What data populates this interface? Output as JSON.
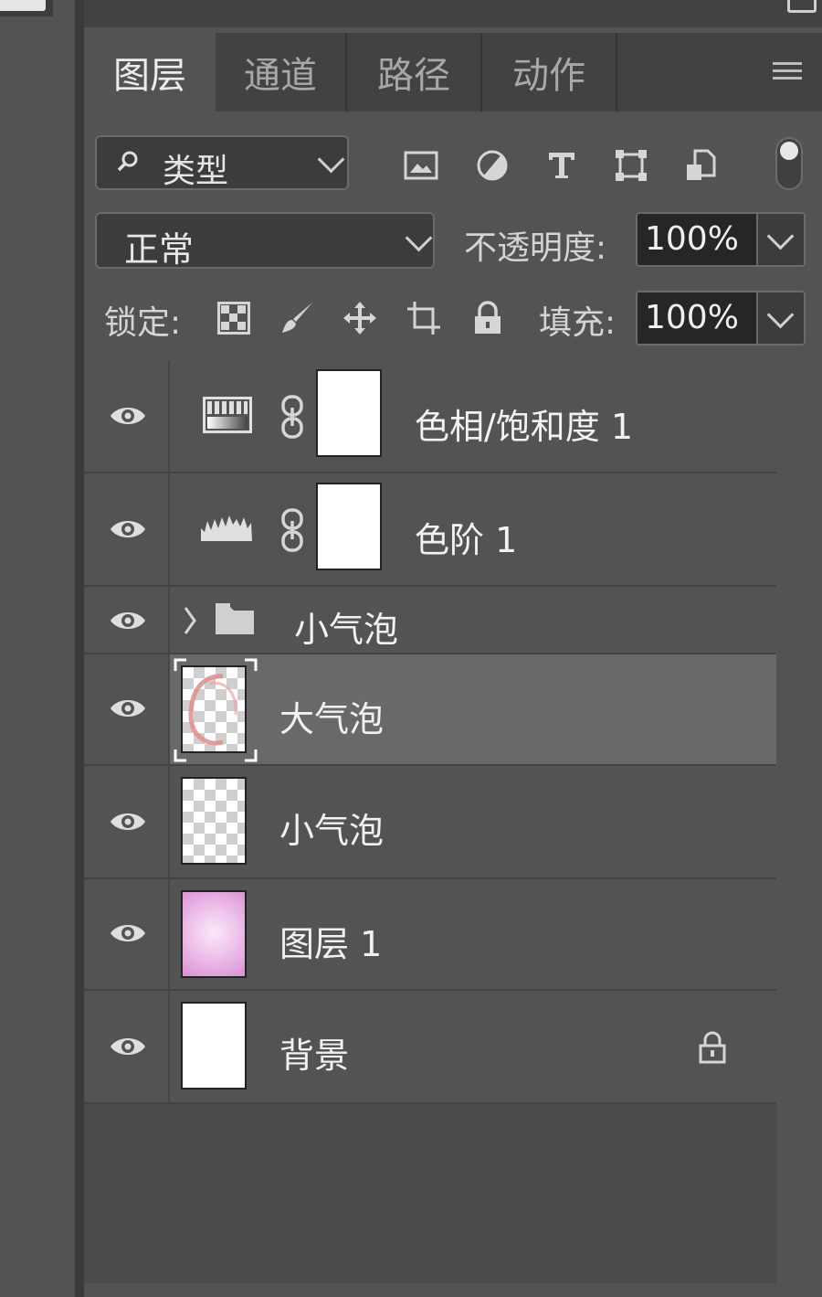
{
  "tabs": [
    {
      "label": "图层",
      "active": true
    },
    {
      "label": "通道",
      "active": false
    },
    {
      "label": "路径",
      "active": false
    },
    {
      "label": "动作",
      "active": false
    }
  ],
  "filter": {
    "kind_label": "类型",
    "icons": [
      "image-filter-icon",
      "adjustment-filter-icon",
      "type-filter-icon",
      "shape-filter-icon",
      "smart-object-filter-icon"
    ]
  },
  "blend": {
    "mode": "正常",
    "opacity_label": "不透明度:",
    "opacity_value": "100%"
  },
  "lock": {
    "label": "锁定:",
    "icons": [
      "lock-transparent-pixels-icon",
      "lock-image-pixels-icon",
      "lock-position-icon",
      "lock-artboard-icon",
      "lock-all-icon"
    ],
    "fill_label": "填充:",
    "fill_value": "100%"
  },
  "layers": [
    {
      "name": "色相/饱和度 1",
      "type": "adjustment-hue",
      "visible": true
    },
    {
      "name": "色阶 1",
      "type": "adjustment-levels",
      "visible": true
    },
    {
      "name": "小气泡",
      "type": "group",
      "visible": true
    },
    {
      "name": "大气泡",
      "type": "pixel",
      "visible": true,
      "selected": true
    },
    {
      "name": "小气泡",
      "type": "pixel",
      "visible": true
    },
    {
      "name": "图层 1",
      "type": "pixel",
      "visible": true
    },
    {
      "name": "背景",
      "type": "background",
      "visible": true,
      "locked": true
    }
  ],
  "colors": {
    "panel_bg": "#535353",
    "selected_row": "#696969",
    "layer1_thumb": "#e9b3e6"
  }
}
